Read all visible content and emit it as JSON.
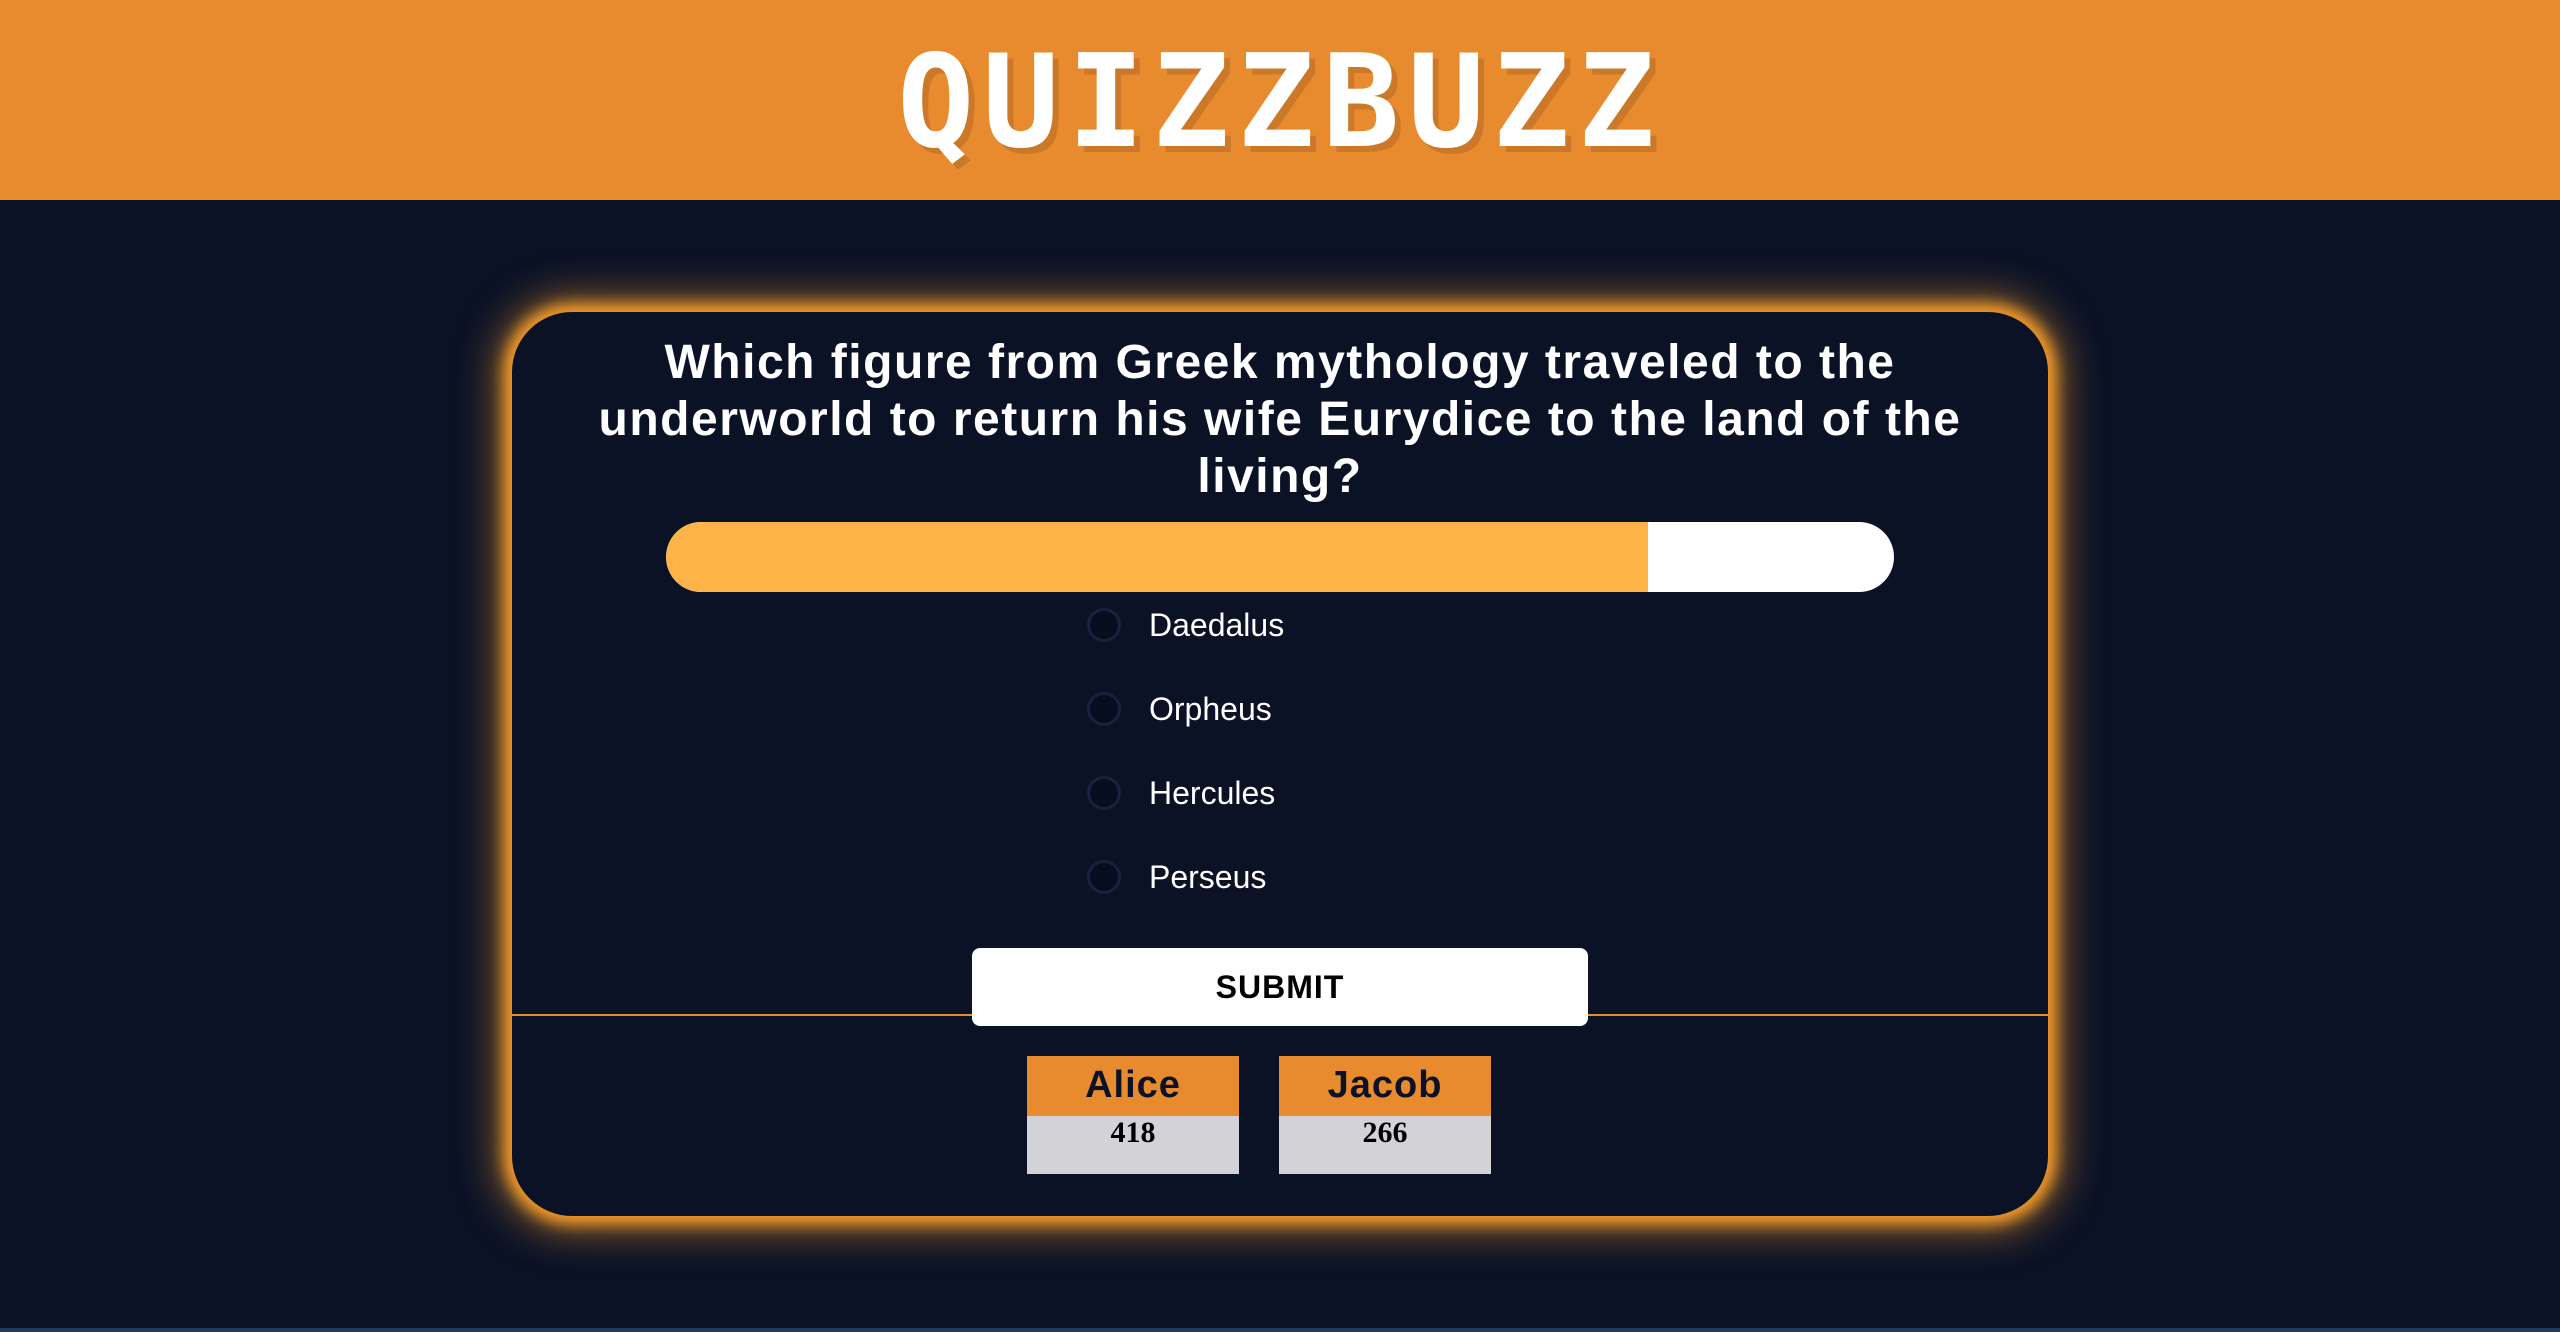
{
  "header": {
    "logo_text": "QUIZZBUZZ"
  },
  "quiz": {
    "question": "Which figure from Greek mythology traveled to the underworld to return his wife Eurydice to the land of the living?",
    "timer_progress": 0.8,
    "options": [
      {
        "label": "Daedalus",
        "selected": false
      },
      {
        "label": "Orpheus",
        "selected": false
      },
      {
        "label": "Hercules",
        "selected": false
      },
      {
        "label": "Perseus",
        "selected": false
      }
    ],
    "submit_label": "SUBMIT"
  },
  "scoreboard": {
    "players": [
      {
        "name": "Alice",
        "score": "418"
      },
      {
        "name": "Jacob",
        "score": "266"
      }
    ]
  },
  "colors": {
    "header_bg": "#e88a2e",
    "page_bg": "#0b1226",
    "progress_fill": "#fdb347",
    "card_glow": "#f39a2a"
  }
}
